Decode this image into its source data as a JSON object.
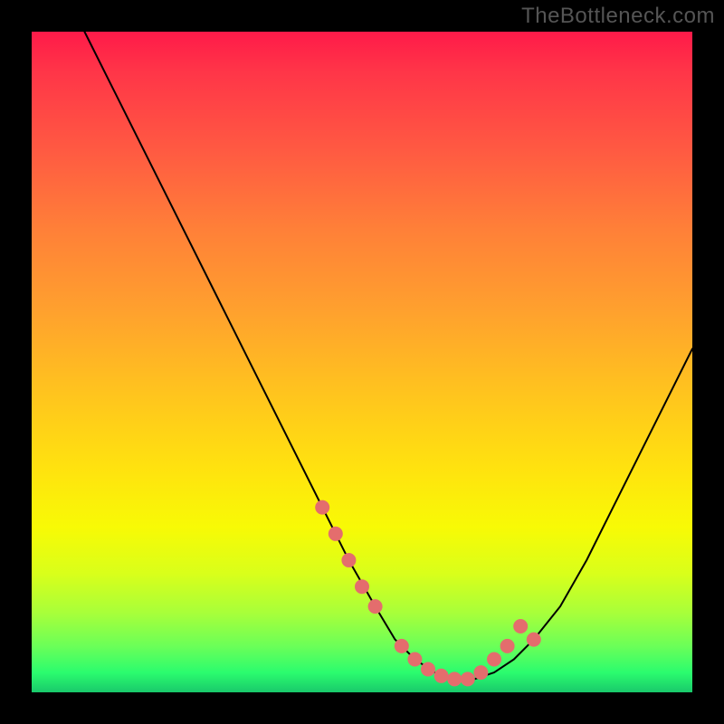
{
  "watermark": "TheBottleneck.com",
  "chart_data": {
    "type": "line",
    "title": "",
    "xlabel": "",
    "ylabel": "",
    "xlim": [
      0,
      100
    ],
    "ylim": [
      0,
      100
    ],
    "grid": false,
    "curve": {
      "x": [
        8,
        12,
        16,
        20,
        24,
        28,
        32,
        36,
        40,
        44,
        48,
        52,
        55,
        58,
        61,
        64,
        67,
        70,
        73,
        76,
        80,
        84,
        88,
        92,
        96,
        100
      ],
      "y": [
        100,
        92,
        84,
        76,
        68,
        60,
        52,
        44,
        36,
        28,
        20,
        13,
        8,
        5,
        3,
        2,
        2,
        3,
        5,
        8,
        13,
        20,
        28,
        36,
        44,
        52
      ]
    },
    "highlight_points": {
      "x": [
        44,
        46,
        48,
        50,
        52,
        56,
        58,
        60,
        62,
        64,
        66,
        68,
        70,
        72,
        74,
        76
      ],
      "y": [
        28,
        24,
        20,
        16,
        13,
        7,
        5,
        3.5,
        2.5,
        2,
        2,
        3,
        5,
        7,
        10,
        8
      ]
    },
    "colors": {
      "curve": "#000000",
      "points": "#e46d6d",
      "gradient_top": "#ff1a49",
      "gradient_bottom": "#19c96b"
    }
  }
}
